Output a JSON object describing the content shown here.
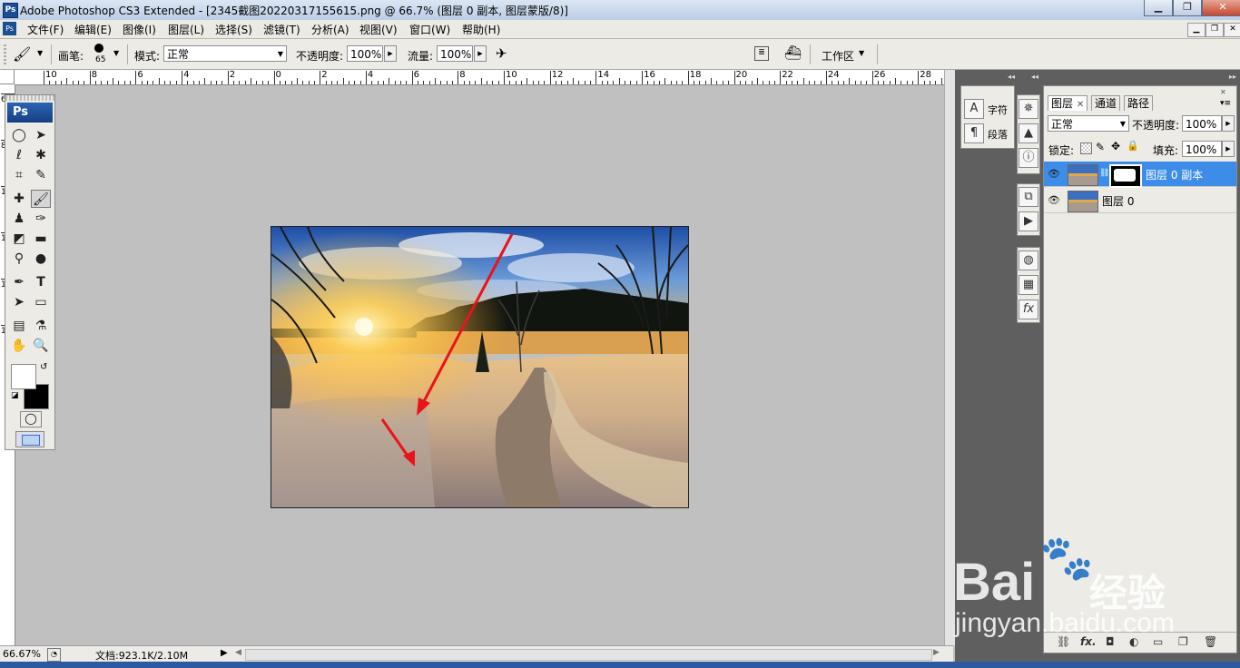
{
  "window": {
    "title": "Adobe Photoshop CS3 Extended - [2345截图20220317155615.png @ 66.7% (图层 0 副本, 图层蒙版/8)]",
    "minimize": "▁",
    "restore": "❐",
    "close": "✕"
  },
  "menubar": {
    "items": [
      "文件(F)",
      "编辑(E)",
      "图像(I)",
      "图层(L)",
      "选择(S)",
      "滤镜(T)",
      "分析(A)",
      "视图(V)",
      "窗口(W)",
      "帮助(H)"
    ]
  },
  "options": {
    "brush_label": "画笔:",
    "brush_size": "65",
    "mode_label": "模式:",
    "mode_value": "正常",
    "opacity_label": "不透明度:",
    "opacity_value": "100%",
    "flow_label": "流量:",
    "flow_value": "100%",
    "workspace_label": "工作区"
  },
  "ruler": {
    "h_labels": [
      "10",
      "8",
      "6",
      "4",
      "2",
      "0",
      "2",
      "4",
      "6",
      "8",
      "10",
      "12",
      "14",
      "16",
      "18",
      "20",
      "22",
      "24",
      "26",
      "28"
    ],
    "v_labels": [
      "6",
      "8",
      "1",
      "1",
      "1",
      "1"
    ]
  },
  "toolbox": {
    "logo": "Ps",
    "text_tool": "T"
  },
  "status": {
    "zoom": "66.67%",
    "doc_info": "文档:923.1K/2.10M"
  },
  "dock1": {
    "character": "字符",
    "paragraph": "段落"
  },
  "layers_panel": {
    "tabs": [
      "图层",
      "通道",
      "路径"
    ],
    "blend_mode": "正常",
    "opacity_label": "不透明度:",
    "opacity_value": "100%",
    "lock_label": "锁定:",
    "fill_label": "填充:",
    "fill_value": "100%",
    "layers": [
      {
        "name": "图层 0 副本",
        "selected": true
      },
      {
        "name": "图层 0",
        "selected": false
      }
    ]
  },
  "watermark": {
    "brand": "Bai",
    "brand_cn": "经验",
    "url": "jingyan.baidu.com"
  },
  "colors": {
    "selection": "#3c8ce8",
    "arrow": "#e8141c"
  }
}
